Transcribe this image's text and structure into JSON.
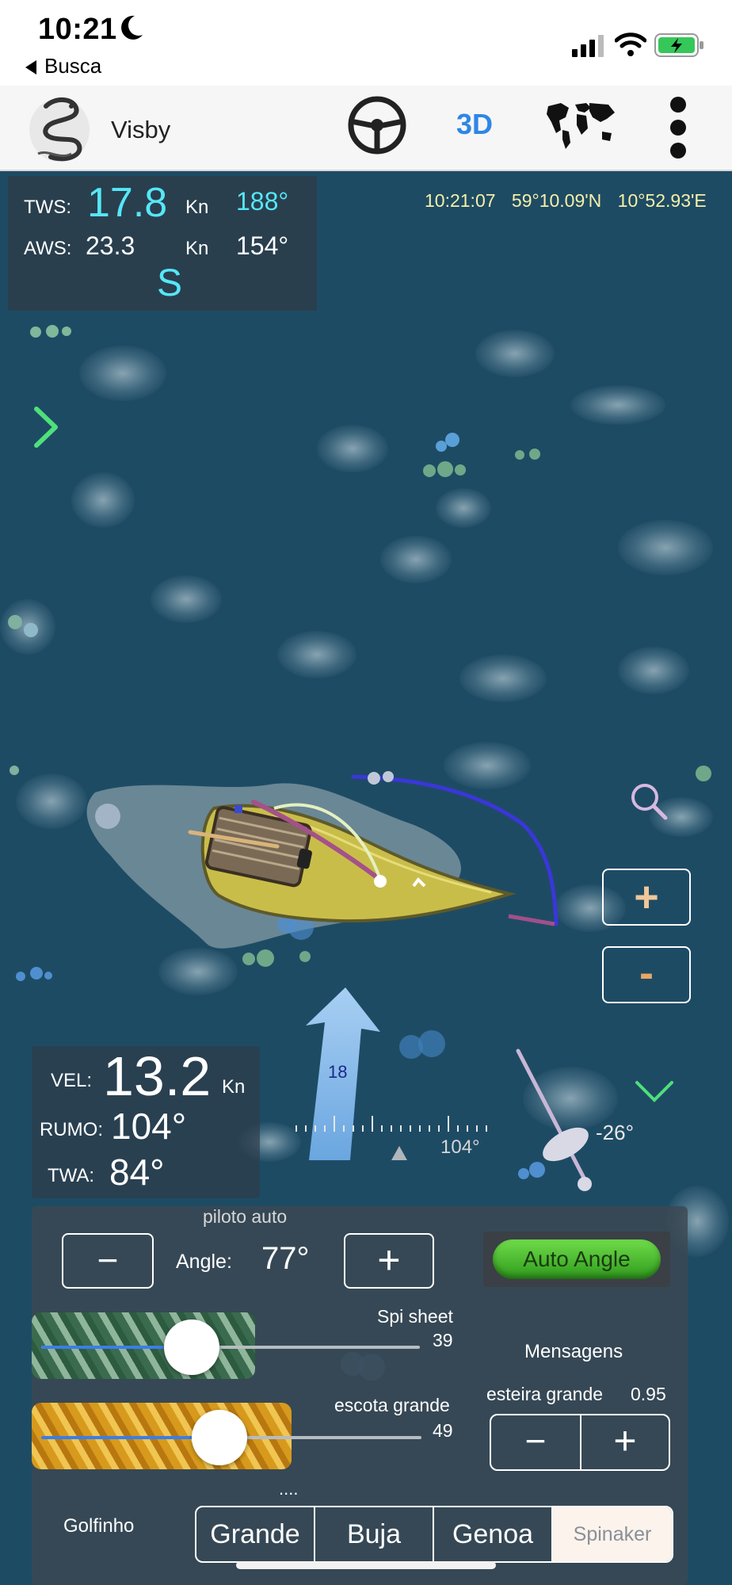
{
  "status_bar": {
    "time": "10:21",
    "back_label": "Busca"
  },
  "toolbar": {
    "boat_name": "Visby",
    "mode_3d": "3D"
  },
  "wind": {
    "tws_label": "TWS:",
    "tws_value": "17.8",
    "tws_unit": "Kn",
    "tws_dir": "188°",
    "aws_label": "AWS:",
    "aws_value": "23.3",
    "aws_unit": "Kn",
    "aws_dir": "154°",
    "heading_letter": "S"
  },
  "top_info": {
    "time": "10:21:07",
    "lat": "59°10.09'N",
    "lon": "10°52.93'E"
  },
  "map": {
    "wind_arrow_value": "18",
    "compass_heading": "104°",
    "rudder_angle": "-26°"
  },
  "zoom": {
    "plus": "+",
    "minus": "-"
  },
  "speed": {
    "vel_label": "VEL:",
    "vel_value": "13.2",
    "vel_unit": "Kn",
    "rumo_label": "RUMO:",
    "rumo_value": "104°",
    "twa_label": "TWA:",
    "twa_value": "84°"
  },
  "autopilot": {
    "title": "piloto auto",
    "angle_label": "Angle:",
    "angle_value": "77°",
    "minus": "−",
    "plus": "+",
    "auto_angle_label": "Auto Angle"
  },
  "sheets": {
    "spi_label": "Spi sheet",
    "spi_value": "39",
    "spi_level": 0.39,
    "main_label": "escota grande",
    "main_value": "49",
    "main_level": 0.49
  },
  "messages_label": "Mensagens",
  "outhaul": {
    "label": "esteira grande",
    "value": "0.95",
    "minus": "−",
    "plus": "+"
  },
  "dots": "....",
  "mode_label": "Golfinho",
  "sails": [
    "Grande",
    "Buja",
    "Genoa",
    "Spinaker"
  ],
  "colors": {
    "accent": "#2f86e6",
    "cyan": "#56e7f7",
    "sea": "#1e4b64",
    "auto_angle": "#3fbf2a"
  }
}
